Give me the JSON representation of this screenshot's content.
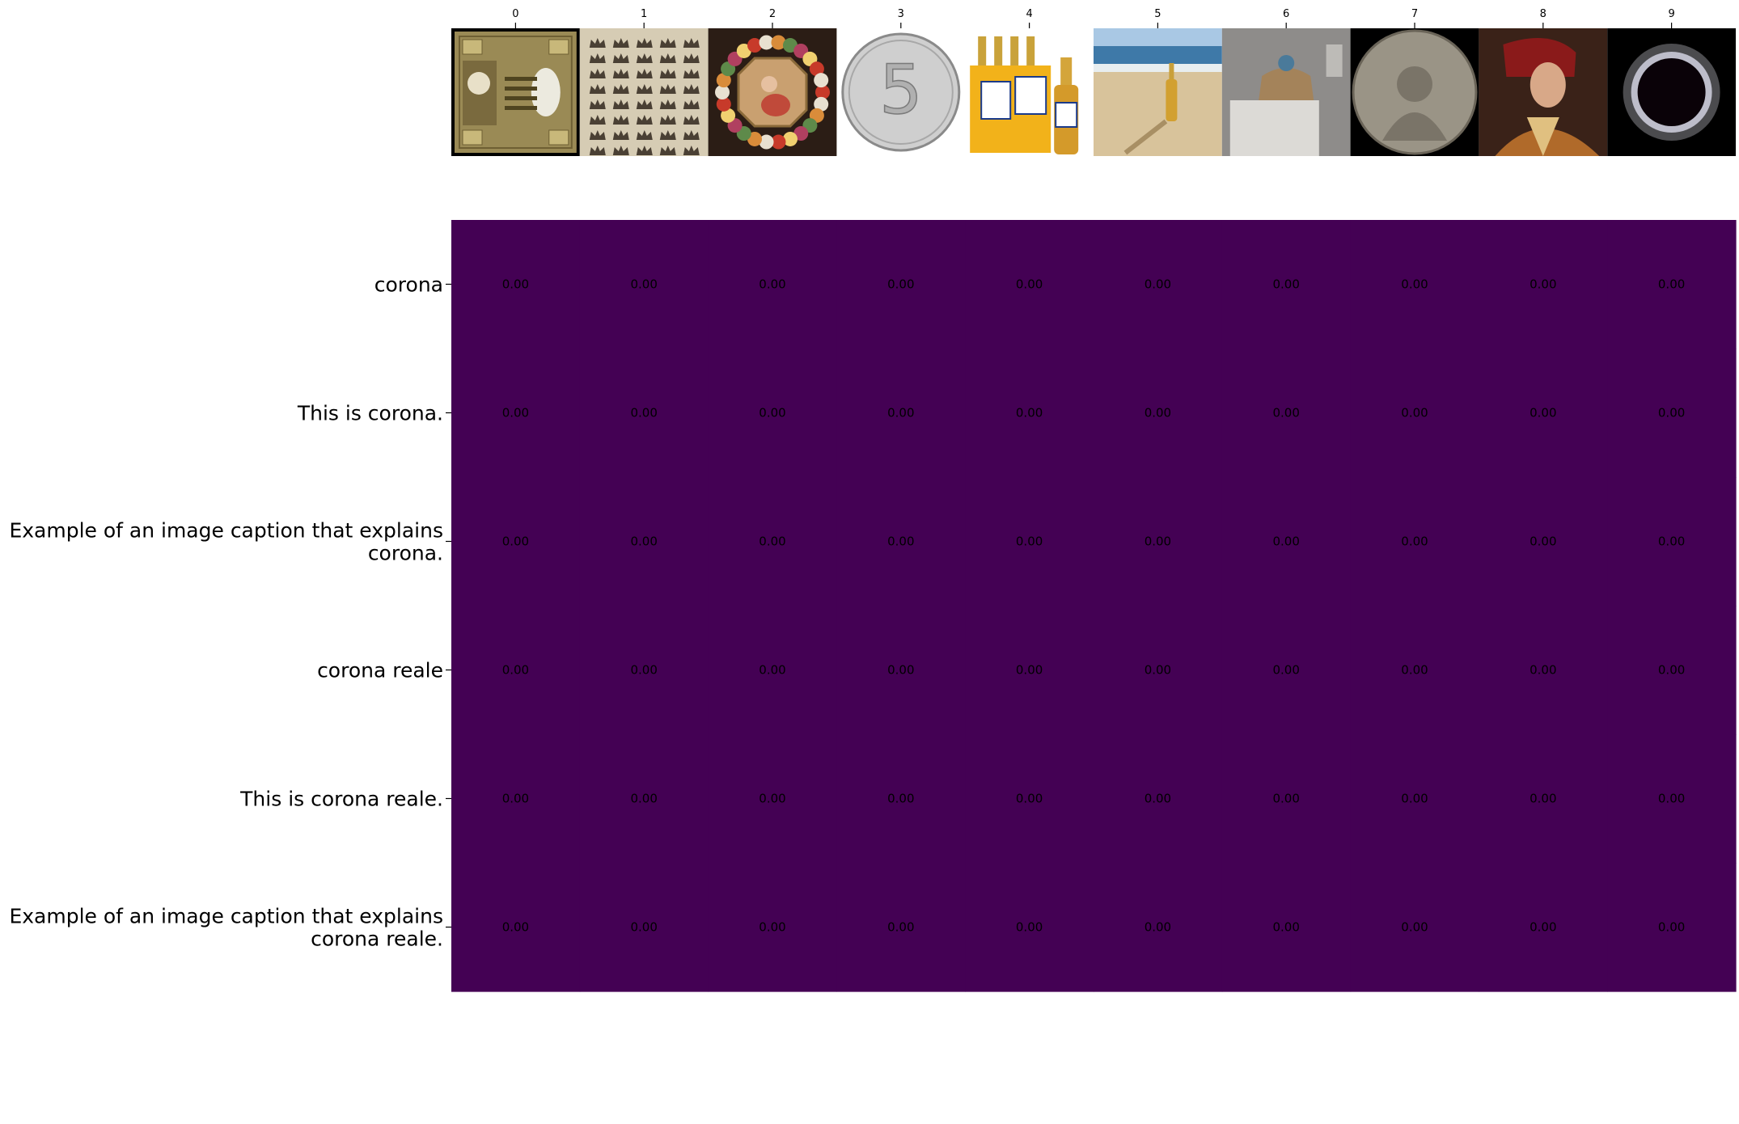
{
  "chart_data": {
    "type": "heatmap",
    "x_tick_labels": [
      "0",
      "1",
      "2",
      "3",
      "4",
      "5",
      "6",
      "7",
      "8",
      "9"
    ],
    "x_images": [
      "banknote-icon",
      "crowns-chart-icon",
      "flower-wreath-painting-icon",
      "coin-icon",
      "beer-bottles-icon",
      "beach-bottle-icon",
      "crown-display-icon",
      "coin-icon",
      "portrait-painting-icon",
      "solar-eclipse-icon"
    ],
    "rows": [
      {
        "label": [
          "corona"
        ],
        "values": [
          0,
          0,
          0,
          0,
          0,
          0,
          0,
          0,
          0,
          0
        ]
      },
      {
        "label": [
          "This is corona."
        ],
        "values": [
          0,
          0,
          0,
          0,
          0,
          0,
          0,
          0,
          0,
          0
        ]
      },
      {
        "label": [
          "Example of an image caption that explains",
          "corona."
        ],
        "values": [
          0,
          0,
          0,
          0,
          0,
          0,
          0,
          0,
          0,
          0
        ]
      },
      {
        "label": [
          "corona reale"
        ],
        "values": [
          0,
          0,
          0,
          0,
          0,
          0,
          0,
          0,
          0,
          0
        ]
      },
      {
        "label": [
          "This is corona reale."
        ],
        "values": [
          0,
          0,
          0,
          0,
          0,
          0,
          0,
          0,
          0,
          0
        ]
      },
      {
        "label": [
          "Example of an image caption that explains",
          "corona reale."
        ],
        "values": [
          0,
          0,
          0,
          0,
          0,
          0,
          0,
          0,
          0,
          0
        ]
      }
    ],
    "cell_label_format": "0.00",
    "colormap": "viridis",
    "cell_color": "#440154",
    "grid": false
  }
}
